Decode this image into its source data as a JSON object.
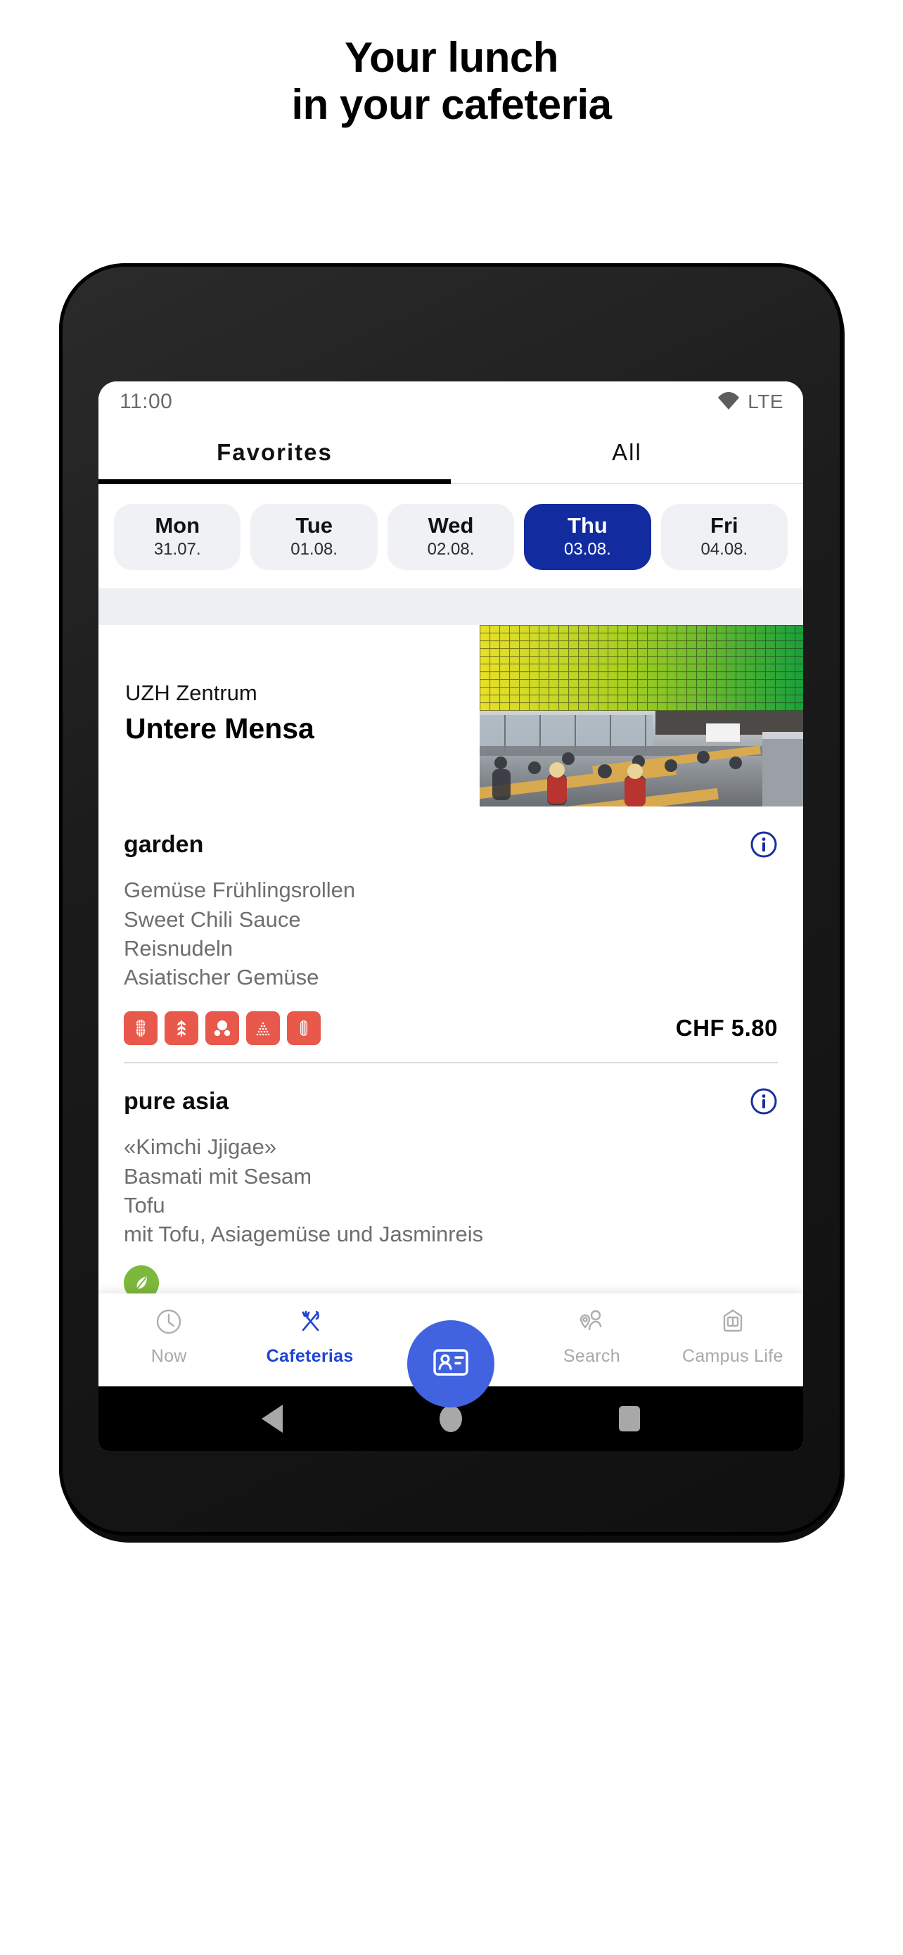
{
  "promo": {
    "line1": "Your lunch",
    "line2": "in your cafeteria"
  },
  "status_bar": {
    "time": "11:00",
    "network": "LTE",
    "wifi_icon": "wifi-icon"
  },
  "tabs": [
    {
      "label": "Favorites",
      "active": true
    },
    {
      "label": "All",
      "active": false
    }
  ],
  "days": [
    {
      "name": "Mon",
      "date": "31.07.",
      "selected": false
    },
    {
      "name": "Tue",
      "date": "01.08.",
      "selected": false
    },
    {
      "name": "Wed",
      "date": "02.08.",
      "selected": false
    },
    {
      "name": "Thu",
      "date": "03.08.",
      "selected": true
    },
    {
      "name": "Fri",
      "date": "04.08.",
      "selected": false
    }
  ],
  "cafeteria": {
    "campus": "UZH Zentrum",
    "name": "Untere Mensa",
    "photo_icon": "cafeteria-photo"
  },
  "menus": [
    {
      "title": "garden",
      "info_icon": "info-icon",
      "lines": [
        "Gemüse Frühlingsrollen",
        "Sweet Chili Sauce",
        "Reisnudeln",
        "Asiatischer Gemüse"
      ],
      "allergens": [
        "peanut-icon",
        "gluten-icon",
        "nuts-icon",
        "sesame-icon",
        "celery-icon"
      ],
      "price": "CHF 5.80"
    },
    {
      "title": "pure asia",
      "info_icon": "info-icon",
      "lines": [
        "«Kimchi Jjigae»",
        "Basmati mit Sesam",
        "Tofu",
        "mit Tofu, Asiagemüse und Jasminreis"
      ],
      "vegan_badge": "leaf-icon",
      "allergens": [
        "soy-icon",
        "gluten-icon"
      ],
      "price": ""
    }
  ],
  "bottom_nav": {
    "items": [
      {
        "label": "Now",
        "icon": "clock-icon",
        "active": false
      },
      {
        "label": "Cafeterias",
        "icon": "cutlery-icon",
        "active": true
      },
      {
        "label": "Search",
        "icon": "person-location-icon",
        "active": false
      },
      {
        "label": "Campus Life",
        "icon": "book-icon",
        "active": false
      }
    ],
    "fab": {
      "icon": "id-card-icon"
    }
  },
  "android_nav": {
    "back": "back-triangle-icon",
    "home": "home-circle-icon",
    "recents": "recents-square-icon"
  },
  "colors": {
    "accent_blue": "#122ca0",
    "nav_blue": "#1f45d6",
    "fab_blue": "#4263e0",
    "allergen_red": "#e8584b",
    "vegan_green": "#7cb83c",
    "chip_grey": "#eff1f4"
  }
}
